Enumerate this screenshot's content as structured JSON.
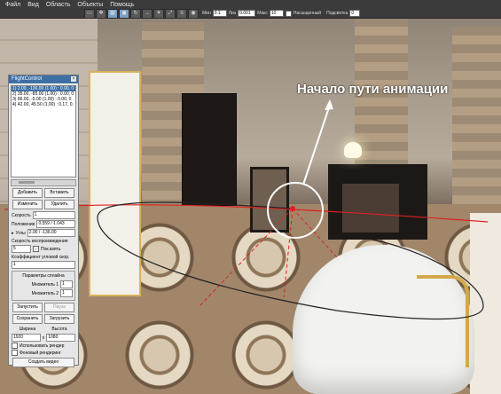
{
  "menu": [
    "Файл",
    "Вид",
    "Область",
    "Объекты",
    "Помощь"
  ],
  "toolbar_options": {
    "min_label": "Мин",
    "min_value": "0.1",
    "step_label": "Лиз",
    "step_value": "0.001",
    "max_label": "Макс",
    "max_value": "10",
    "saturated_label": "Насыщенный",
    "highlight_label": "Подсветка",
    "highlight_value": "0"
  },
  "annotation": "Начало пути анимации",
  "flight_control": {
    "title": "FlightControl",
    "keys": [
      "1) 2.00, -136.00 (1.00) : 0.00, 0",
      "2) 35.00, -85.00 (1.00) : 0.00, 0",
      "3) 86.00, -5.00 (1.00) : 0.00, 0",
      "4) 42.00, 45.50 (1.00) : 0.17, 0."
    ],
    "selected_index": 0,
    "add_label": "Добавить",
    "insert_label": "Вставить",
    "edit_label": "Изменить",
    "delete_label": "Удалить",
    "speed_label": "Скорость",
    "speed_value": "1",
    "position_label": "Положение",
    "position_value": "0.559 / 1.043",
    "angles_label": "Углы",
    "angles_value": "2.00 / -136.00",
    "playback_speed_label": "Скорость воспроизведения",
    "playback_speed_value": "5",
    "loop_label": "Пок.взять",
    "angular_coef_label": "Коэффициент угловой скор.",
    "angular_coef_value": "1",
    "spline_group_label": "Параметры сплайна",
    "mult1_label": "Множитель 1",
    "mult1_value": "1",
    "mult2_label": "Множитель 2",
    "mult2_value": "1",
    "start_label": "Запустить",
    "pause_label": "Пауза",
    "save_label": "Сохранить",
    "load_label": "Загрузить",
    "width_label": "Ширина",
    "height_label": "Высота",
    "width_value": "1920",
    "height_value": "1080",
    "use_renderer_label": "Использовать рендер",
    "background_render_label": "Фоновый рендеринг",
    "create_video_label": "Создать видео"
  }
}
